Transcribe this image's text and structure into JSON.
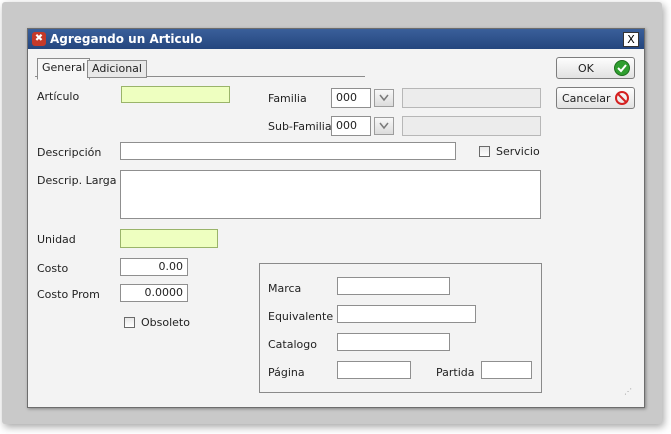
{
  "window": {
    "title": "Agregando un Articulo",
    "close_label": "X"
  },
  "tabs": [
    {
      "label": "General",
      "active": true
    },
    {
      "label": "Adicional",
      "active": false
    }
  ],
  "fields": {
    "articulo": {
      "label": "Artículo",
      "value": ""
    },
    "familia": {
      "label": "Familia",
      "code": "000",
      "description": ""
    },
    "subfamilia": {
      "label": "Sub-Familia",
      "code": "000",
      "description": ""
    },
    "descripcion": {
      "label": "Descripción",
      "value": ""
    },
    "servicio": {
      "label": "Servicio",
      "checked": false
    },
    "descrip_larga": {
      "label": "Descrip. Larga",
      "value": ""
    },
    "unidad": {
      "label": "Unidad",
      "value": ""
    },
    "costo": {
      "label": "Costo",
      "value": "0.00"
    },
    "costo_prom": {
      "label": "Costo Prom",
      "value": "0.0000"
    },
    "obsoleto": {
      "label": "Obsoleto",
      "checked": false
    }
  },
  "group": {
    "marca": {
      "label": "Marca",
      "value": ""
    },
    "equivalente": {
      "label": "Equivalente",
      "value": ""
    },
    "catalogo": {
      "label": "Catalogo",
      "value": ""
    },
    "pagina": {
      "label": "Página",
      "value": ""
    },
    "partida": {
      "label": "Partida",
      "value": ""
    }
  },
  "buttons": {
    "ok": "OK",
    "cancel": "Cancelar"
  },
  "colors": {
    "titlebar": "#2d5089",
    "required_field": "#eeffc0",
    "ok_icon": "#2f9e2f",
    "cancel_icon": "#d42020"
  },
  "icons": {
    "title": "app-tools-icon",
    "ok": "check-icon",
    "cancel": "prohibited-icon"
  }
}
